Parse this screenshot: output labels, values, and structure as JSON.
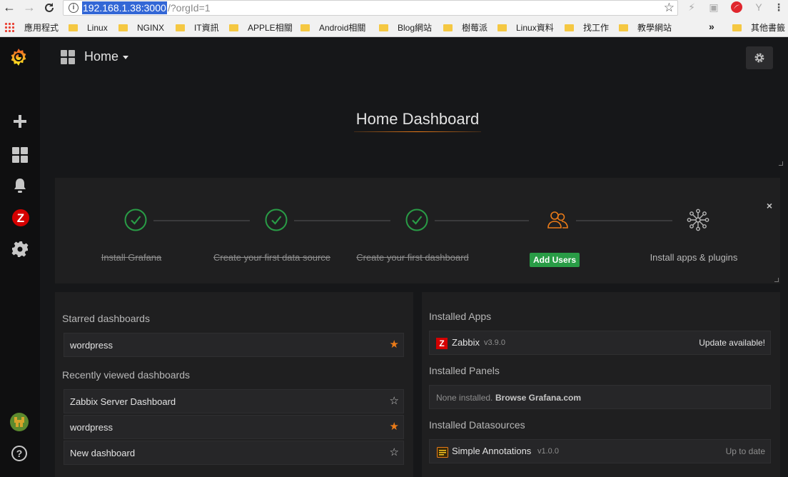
{
  "browser": {
    "url_host": "192.168.1.38:3000",
    "url_path": "/?orgId=1",
    "bookmarks": [
      {
        "label": "應用程式",
        "folder": false
      },
      {
        "label": "Linux",
        "folder": true
      },
      {
        "label": "NGINX",
        "folder": true
      },
      {
        "label": "IT資訊",
        "folder": true
      },
      {
        "label": "APPLE相關",
        "folder": true
      },
      {
        "label": "Android相關",
        "folder": true
      },
      {
        "label": "Blog網站",
        "folder": true
      },
      {
        "label": "樹莓派",
        "folder": true
      },
      {
        "label": "Linux資料",
        "folder": true
      },
      {
        "label": "找工作",
        "folder": true
      },
      {
        "label": "教學網站",
        "folder": true
      }
    ],
    "overflow": "»",
    "other_bookmarks": "其他書籤"
  },
  "sidebar": {
    "icons": [
      "grafana-logo-icon",
      "plus-icon",
      "dashboards-icon",
      "alert-bell-icon",
      "zabbix-icon",
      "config-gear-icon",
      "user-avatar-icon",
      "help-icon"
    ],
    "help_label": "?",
    "zabbix_label": "Z"
  },
  "topbar": {
    "title": "Home"
  },
  "home_dashboard": {
    "title": "Home Dashboard"
  },
  "steps": {
    "items": [
      {
        "label": "Install Grafana",
        "done": true
      },
      {
        "label": "Create your first data source",
        "done": true
      },
      {
        "label": "Create your first dashboard",
        "done": true
      },
      {
        "label": "Add Users",
        "done": false,
        "active": true
      },
      {
        "label": "Install apps & plugins",
        "done": false
      }
    ],
    "close": "×",
    "accent_green": "#299c46",
    "accent_orange": "#eb7b18"
  },
  "left_panel": {
    "starred_title": "Starred dashboards",
    "starred": [
      {
        "label": "wordpress",
        "starred": true
      }
    ],
    "recent_title": "Recently viewed dashboards",
    "recent": [
      {
        "label": "Zabbix Server Dashboard",
        "starred": false
      },
      {
        "label": "wordpress",
        "starred": true
      },
      {
        "label": "New dashboard",
        "starred": false
      }
    ]
  },
  "right_panel": {
    "apps_title": "Installed Apps",
    "apps": [
      {
        "name": "Zabbix",
        "version": "v3.9.0",
        "status": "Update available!"
      }
    ],
    "panels_title": "Installed Panels",
    "panels_none_prefix": "None installed.",
    "panels_none_link": "Browse Grafana.com",
    "datasources_title": "Installed Datasources",
    "datasources": [
      {
        "name": "Simple Annotations",
        "version": "v1.0.0",
        "status": "Up to date"
      }
    ]
  }
}
